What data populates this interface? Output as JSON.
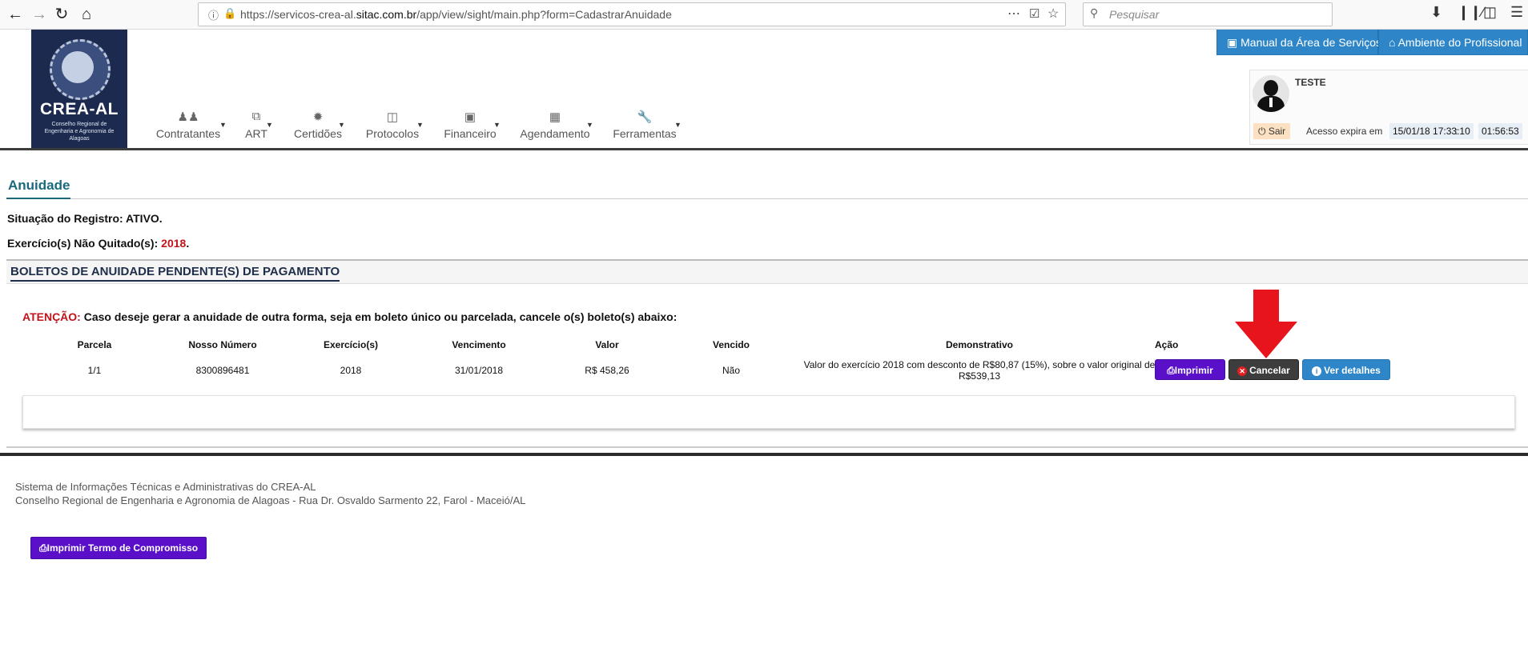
{
  "browser": {
    "url_prefix": "https://servicos-crea-al.",
    "url_domain": "sitac.com.br",
    "url_path": "/app/view/sight/main.php?form=CadastrarAnuidade",
    "search_placeholder": "Pesquisar",
    "icons": [
      "back-arrow-icon",
      "forward-arrow-icon",
      "reload-icon",
      "home-icon",
      "info-icon",
      "lock-icon",
      "more-icon",
      "pocket-icon",
      "star-icon",
      "search-icon",
      "download-icon",
      "library-icon",
      "sidebar-icon",
      "menu-icon"
    ]
  },
  "logo": {
    "title": "CREA-AL",
    "subtitle": "Conselho Regional de Engenharia e Agronomia de Alagoas"
  },
  "menu": [
    {
      "label": "Contratantes",
      "icon": "users-icon"
    },
    {
      "label": "ART",
      "icon": "copy-icon"
    },
    {
      "label": "Certidões",
      "icon": "certificate-icon"
    },
    {
      "label": "Protocolos",
      "icon": "inbox-icon"
    },
    {
      "label": "Financeiro",
      "icon": "money-icon"
    },
    {
      "label": "Agendamento",
      "icon": "calendar-icon"
    },
    {
      "label": "Ferramentas",
      "icon": "wrench-icon"
    }
  ],
  "top_buttons": {
    "manual": "Manual da Área de Serviços",
    "ambiente": "Ambiente do Profissional"
  },
  "user": {
    "name": "TESTE",
    "logout": "Sair",
    "expire_label": "Acesso expira em",
    "expire_datetime": "15/01/18 17:33:10",
    "separator": ":",
    "remaining": "01:56:53"
  },
  "page": {
    "title": "Anuidade",
    "situacao_label": "Situação do Registro: ATIVO.",
    "exercicio_label": "Exercício(s) Não Quitado(s):",
    "exercicio_value": "2018",
    "exercicio_end": "."
  },
  "panel": {
    "title": "BOLETOS DE ANUIDADE PENDENTE(S) DE PAGAMENTO",
    "attention_label": "ATENÇÃO:",
    "attention_text": "Caso deseje gerar a anuidade de outra forma, seja em boleto único ou parcelada, cancele o(s) boleto(s) abaixo:"
  },
  "table": {
    "headers": [
      "Parcela",
      "Nosso Número",
      "Exercício(s)",
      "Vencimento",
      "Valor",
      "Vencido",
      "Demonstrativo",
      "Ação"
    ],
    "row": {
      "parcela": "1/1",
      "nosso_numero": "8300896481",
      "exercicio": "2018",
      "vencimento": "31/01/2018",
      "valor": "R$ 458,26",
      "vencido": "Não",
      "demonstrativo": "Valor do exercício 2018 com desconto de R$80,87 (15%), sobre o valor original de R$539,13"
    },
    "actions": {
      "print": "Imprimir",
      "cancel": "Cancelar",
      "details": "Ver detalhes"
    }
  },
  "term_button": "Imprimir Termo de Compromisso",
  "footer": {
    "line1": "Sistema de Informações Técnicas e Administrativas do CREA-AL",
    "line2": "Conselho Regional de Engenharia e Agronomia de Alagoas - Rua Dr. Osvaldo Sarmento 22, Farol - Maceió/AL"
  },
  "colors": {
    "brand_blue": "#2e86c8",
    "logo_navy": "#1b2a4e",
    "purple_button": "#5a0fc8",
    "alert_red": "#c0131a",
    "arrow_red": "#e8141c"
  }
}
